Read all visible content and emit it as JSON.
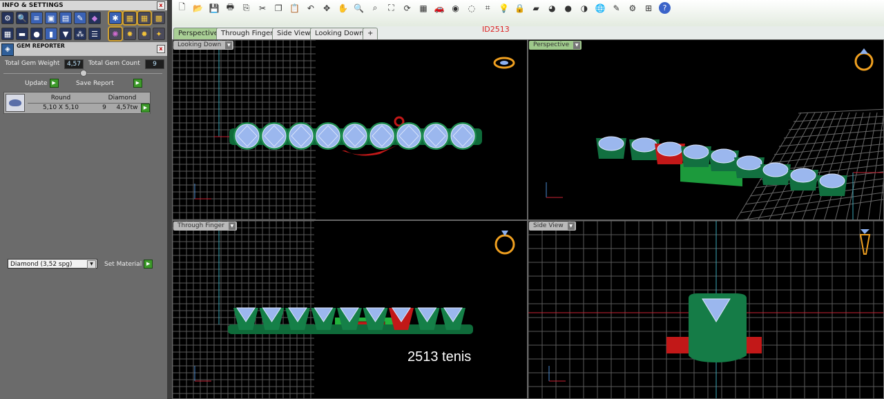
{
  "info_panel": {
    "title": "INFO & SETTINGS",
    "close": "x"
  },
  "gem_reporter": {
    "title": "GEM REPORTER",
    "close": "x",
    "total_weight_label": "Total Gem Weight",
    "total_weight_value": "4,57",
    "total_count_label": "Total Gem Count",
    "total_count_value": "9",
    "update_label": "Update",
    "save_report_label": "Save Report",
    "table": {
      "col_shape": "Round",
      "col_material": "Diamond",
      "row": {
        "size": "5,10 X 5,10",
        "count": "9",
        "weight": "4,57tw"
      }
    },
    "material_value": "Diamond    (3,52 spg)",
    "set_material_label": "Set Material"
  },
  "toolbar": {
    "icons": [
      "new-icon",
      "open-icon",
      "save-icon",
      "print-icon",
      "copy-icon",
      "cut-icon",
      "duplicate-icon",
      "paste-icon",
      "undo-icon",
      "pan-icon",
      "hand-icon",
      "zoom-icon",
      "zoom-window-icon",
      "zoom-extents-icon",
      "rotate-icon",
      "grid-icon",
      "car-icon",
      "eye-icon",
      "circle-icon",
      "snap-icon",
      "bulb-icon",
      "lock-icon",
      "render-icon",
      "color-wheel-icon",
      "sphere-icon",
      "sphere-dark-icon",
      "globe-icon",
      "wand-icon",
      "settings-icon",
      "layout-icon",
      "help-icon"
    ]
  },
  "tabs": [
    "Perspective",
    "Through Finger",
    "Side View",
    "Looking Down",
    "+"
  ],
  "document_id": "ID2513",
  "viewports": {
    "top_left": "Looking Down",
    "top_right": "Perspective",
    "bottom_left": "Through Finger",
    "bottom_right": "Side View"
  },
  "caption": "2513 tenis",
  "colors": {
    "gem": "#9bb7ee",
    "metal": "#1d8a4f",
    "selected": "#d21b1b",
    "accent_tab": "#a9cf95"
  }
}
